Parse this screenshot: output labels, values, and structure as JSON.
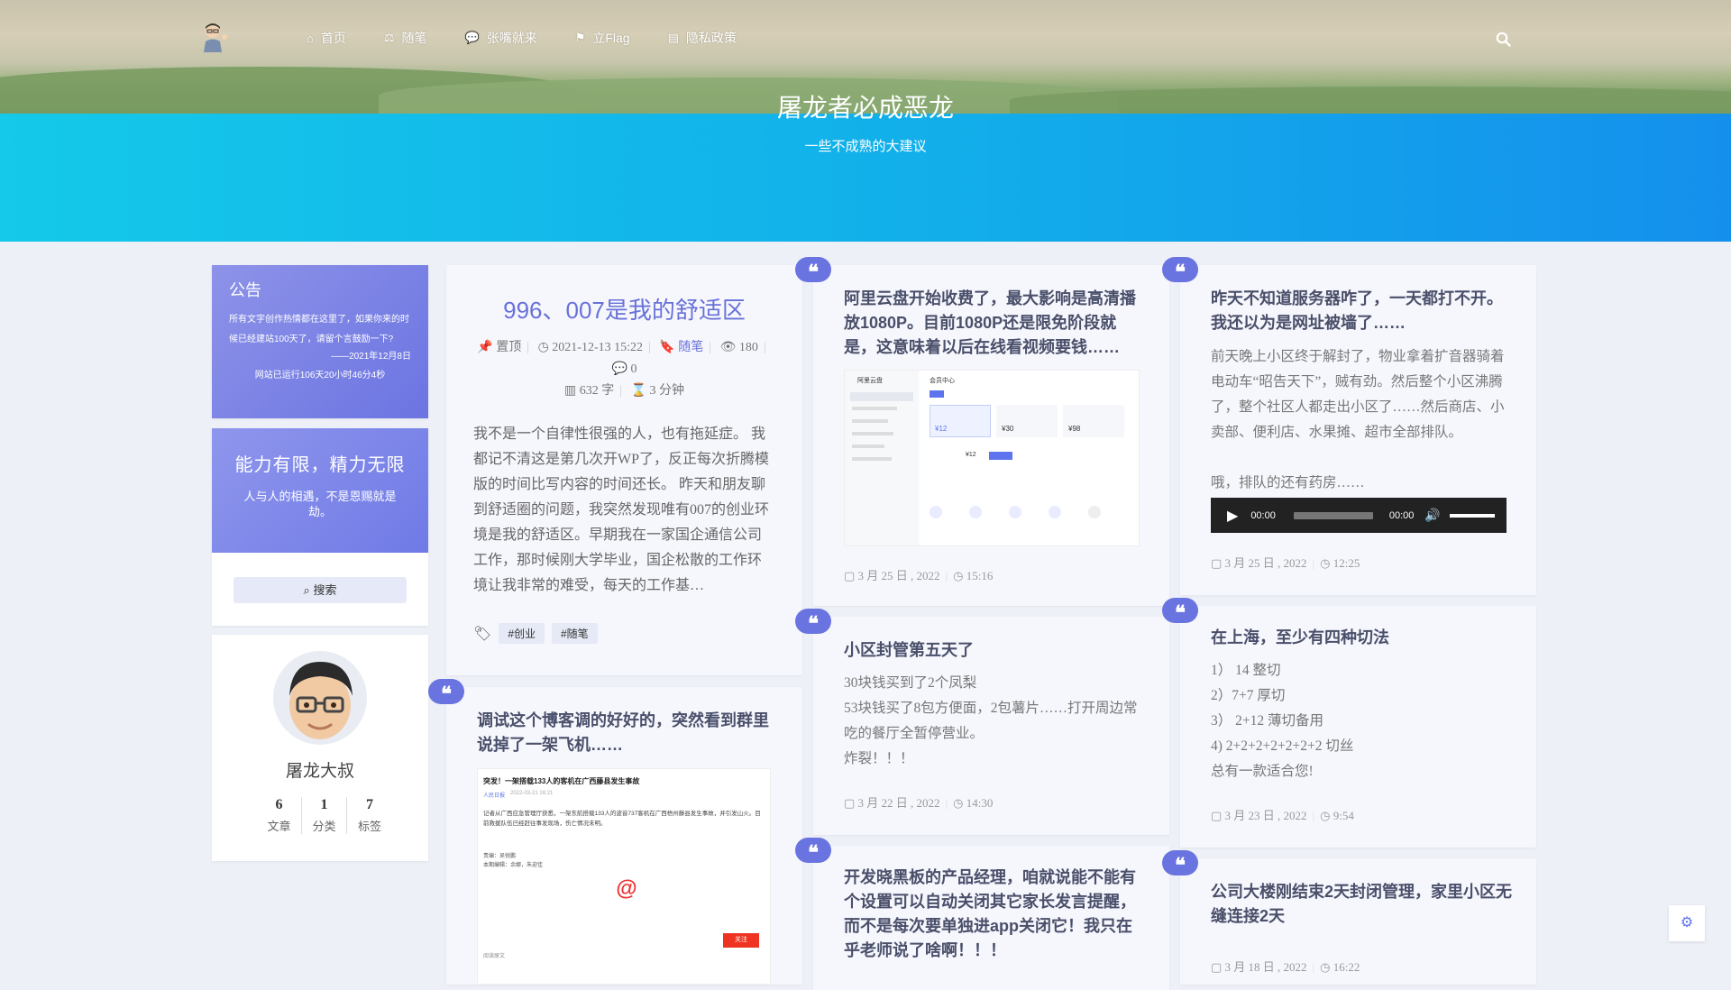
{
  "nav": {
    "items": [
      {
        "label": "首页",
        "icon": "home-icon"
      },
      {
        "label": "随笔",
        "icon": "scale-icon"
      },
      {
        "label": "张嘴就来",
        "icon": "chat-icon"
      },
      {
        "label": "立Flag",
        "icon": "flag-icon"
      },
      {
        "label": "隐私政策",
        "icon": "card-icon"
      }
    ]
  },
  "site": {
    "title": "屠龙者必成恶龙",
    "subtitle": "一些不成熟的大建议"
  },
  "notice": {
    "title": "公告",
    "body": "所有文字创作热情都在这里了，如果你来的时候已经建站100天了，请留个言鼓励一下?",
    "signature": "——2021年12月8日",
    "runtime": "网站已运行106天20小时46分4秒"
  },
  "motto": {
    "title": "能力有限，精力无限",
    "text": "人与人的相遇，不是恩赐就是劫。"
  },
  "search": {
    "label": "搜索"
  },
  "profile": {
    "name": "屠龙大叔",
    "stats": [
      {
        "num": "6",
        "label": "文章"
      },
      {
        "num": "1",
        "label": "分类"
      },
      {
        "num": "7",
        "label": "标签"
      }
    ]
  },
  "featured": {
    "title": "996、007是我的舒适区",
    "sticky": "置顶",
    "date": "2021-12-13 15:22",
    "category": "随笔",
    "views": "180",
    "comments": "0",
    "words": "632 字",
    "read_time": "3 分钟",
    "excerpt": "我不是一个自律性很强的人，也有拖延症。 我都记不清这是第几次开WP了，反正每次折腾模版的时间比写内容的时间还长。 昨天和朋友聊到舒适圈的问题，我突然发现唯有007的创业环境是我的舒适区。早期我在一家国企通信公司工作，那时候刚大学毕业，国企松散的工作环境让我非常的难受，每天的工作基…",
    "tags": [
      "#创业",
      "#随笔"
    ]
  },
  "posts": {
    "aliyun": {
      "title": "阿里云盘开始收费了，最大影响是高清播放1080P。目前1080P还是限免阶段就是，这意味着以后在线看视频要钱……",
      "date": "3 月 25 日 , 2022",
      "time": "15:16",
      "shot": {
        "brand": "阿里云盘",
        "menu_title": "会员中心",
        "prices": [
          "¥12",
          "¥30",
          "¥98"
        ],
        "plan_price": "¥12"
      }
    },
    "server": {
      "title": "昨天不知道服务器咋了，一天都打不开。我还以为是网址被墙了……",
      "text1": "前天晚上小区终于解封了，物业拿着扩音器骑着电动车“昭告天下”，贼有劲。然后整个小区沸腾了，整个社区人都走出小区了……然后商店、小卖部、便利店、水果摊、超市全部排队。",
      "text2": "哦，排队的还有药房……",
      "audio_current": "00:00",
      "audio_total": "00:00",
      "date": "3 月 25 日 , 2022",
      "time": "12:25"
    },
    "lockdown": {
      "title": "小区封管第五天了",
      "lines": [
        "30块钱买到了2个凤梨",
        "53块钱买了8包方便面，2包薯片……打开周边常吃的餐厅全暂停营业。",
        "炸裂！！！"
      ],
      "date": "3 月 22 日 , 2022",
      "time": "14:30"
    },
    "cut": {
      "title": "在上海，至少有四种切法",
      "lines": [
        "1） 14 整切",
        "2）7+7 厚切",
        "3） 2+12 薄切备用",
        "4) 2+2+2+2+2+2+2 切丝",
        "总有一款适合您!"
      ],
      "date": "3 月 23 日 , 2022",
      "time": "9:54"
    },
    "plane": {
      "title": "调试这个博客调的好好的，突然看到群里说掉了一架飞机……",
      "shot": {
        "headline": "突发！一架搭载133人的客机在广西藤县发生事故",
        "source": "人民日报",
        "timestamp": "2022-03-21 16:21",
        "body": "记者从广西应急管理厅获悉，一架东航搭载133人的波音737客机在广西梧州藤县发生事故，并引发山火。目前救援队伍已经赶往事发现场，伤亡情况未明。",
        "editor": "责编：吴锐鹏\n本期编辑：余娜，朱迎佳",
        "badge": "关注",
        "foot": "阅读原文"
      }
    },
    "xiaoheiban": {
      "title": "开发晓黑板的产品经理，咱就说能不能有个设置可以自动关闭其它家长发言提醒，而不是每次要单独进app关闭它！我只在乎老师说了啥啊！！！"
    },
    "building": {
      "title": "公司大楼刚结束2天封闭管理，家里小区无缝连接2天",
      "date": "3 月 18 日 , 2022",
      "time": "16:22"
    }
  },
  "colors": {
    "accent": "#6a74e0",
    "banner_start": "#14c9e9",
    "banner_end": "#1490ec"
  }
}
